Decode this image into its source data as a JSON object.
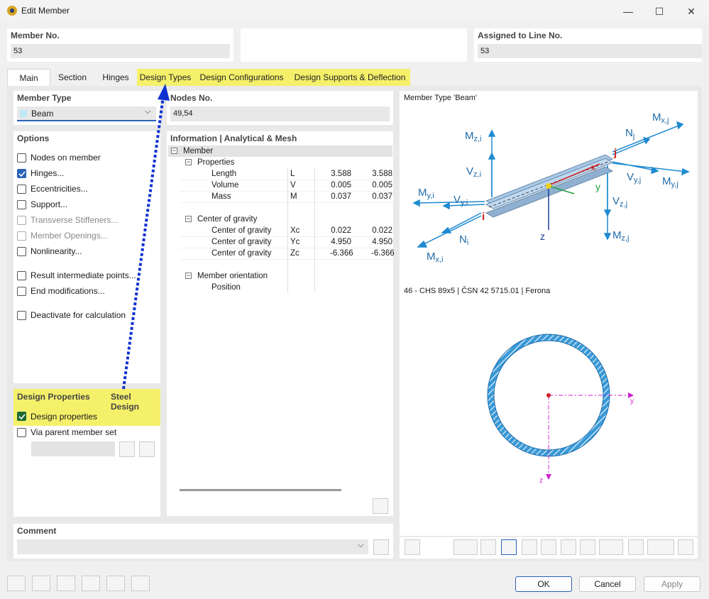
{
  "window": {
    "title": "Edit Member"
  },
  "header": {
    "member_no_label": "Member No.",
    "member_no_value": "53",
    "assigned_label": "Assigned to Line No.",
    "assigned_value": "53"
  },
  "tabs": [
    "Main",
    "Section",
    "Hinges",
    "Design Types",
    "Design Configurations",
    "Design Supports & Deflection"
  ],
  "left": {
    "member_type_label": "Member Type",
    "member_type_value": "Beam",
    "options_label": "Options",
    "options": [
      {
        "label": "Nodes on member",
        "checked": false,
        "disabled": false
      },
      {
        "label": "Hinges...",
        "checked": true,
        "disabled": false
      },
      {
        "label": "Eccentricities...",
        "checked": false,
        "disabled": false
      },
      {
        "label": "Support...",
        "checked": false,
        "disabled": false
      },
      {
        "label": "Transverse Stiffeners...",
        "checked": false,
        "disabled": true
      },
      {
        "label": "Member Openings...",
        "checked": false,
        "disabled": true
      },
      {
        "label": "Nonlinearity...",
        "checked": false,
        "disabled": false
      },
      {
        "label": "Result intermediate points...",
        "checked": false,
        "disabled": false
      },
      {
        "label": "End modifications...",
        "checked": false,
        "disabled": false
      },
      {
        "label": "Deactivate for calculation",
        "checked": false,
        "disabled": false
      }
    ],
    "design_props_label": "Design Properties",
    "steel_design_label": "Steel Design",
    "design_props_cb": "Design properties",
    "via_parent_cb": "Via parent member set"
  },
  "middle": {
    "nodes_label": "Nodes No.",
    "nodes_value": "49,54",
    "info_label": "Information | Analytical & Mesh",
    "tree": {
      "member": "Member",
      "properties": "Properties",
      "props": [
        {
          "name": "Length",
          "sym": "L",
          "v1": "3.588",
          "v2": "3.588"
        },
        {
          "name": "Volume",
          "sym": "V",
          "v1": "0.005",
          "v2": "0.005"
        },
        {
          "name": "Mass",
          "sym": "M",
          "v1": "0.037",
          "v2": "0.037"
        }
      ],
      "cog": "Center of gravity",
      "cog_rows": [
        {
          "name": "Center of gravity",
          "sym": "Xc",
          "v1": "0.022",
          "v2": "0.022"
        },
        {
          "name": "Center of gravity",
          "sym": "Yc",
          "v1": "4.950",
          "v2": "4.950"
        },
        {
          "name": "Center of gravity",
          "sym": "Zc",
          "v1": "-6.366",
          "v2": "-6.366"
        }
      ],
      "orientation": "Member orientation",
      "position": "Position"
    }
  },
  "right": {
    "member_type_title": "Member Type 'Beam'",
    "section_title": "46 - CHS 89x5 | ČSN 42 5715.01 | Ferona",
    "diagram_labels": {
      "mzi": "Mz,i",
      "vzi": "Vz,i",
      "myi": "My,i",
      "vyi": "Vy,i",
      "ni": "Ni",
      "mxi": "Mx,i",
      "i": "i",
      "j": "j",
      "x": "x",
      "y": "y",
      "z": "z",
      "mxj": "Mx,j",
      "nj": "Nj",
      "vyj": "Vy,j",
      "myj": "My,j",
      "vzj": "Vz,j",
      "mzj": "Mz,j",
      "sec_y": "y",
      "sec_z": "z"
    }
  },
  "comment": {
    "label": "Comment",
    "value": ""
  },
  "footer": {
    "ok": "OK",
    "cancel": "Cancel",
    "apply": "Apply"
  },
  "colors": {
    "highlight": "#f5f06a",
    "accent": "#2a62b8",
    "arrow": "#1030d0",
    "diagram": "#1e8ad0"
  }
}
